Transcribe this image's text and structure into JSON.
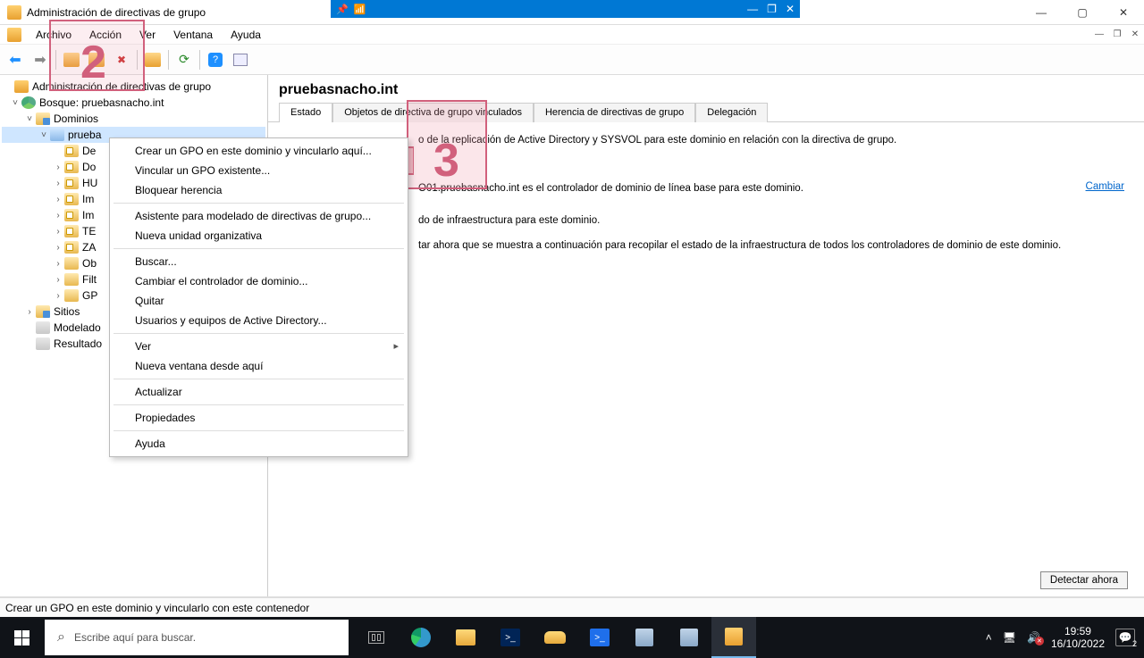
{
  "window": {
    "title": "Administración de directivas de grupo"
  },
  "remote_bar": {
    "min": "—",
    "restore": "❐",
    "close": "✕"
  },
  "outer_win": {
    "min": "—",
    "max": "▢",
    "close": "✕"
  },
  "mdi": {
    "min": "—",
    "restore": "❐",
    "close": "✕"
  },
  "menu": {
    "archivo": "Archivo",
    "accion": "Acción",
    "ver": "Ver",
    "ventana": "Ventana",
    "ayuda": "Ayuda"
  },
  "tree": {
    "root": "Administración de directivas de grupo",
    "forest": "Bosque: pruebasnacho.int",
    "domains": "Dominios",
    "domain": "prueba",
    "items": [
      "De",
      "Do",
      "HU",
      "Im",
      "Im",
      "TE",
      "ZA",
      "Ob",
      "Filt",
      "GP"
    ],
    "sitios": "Sitios",
    "modelado": "Modelado",
    "resultados": "Resultado"
  },
  "ctx": {
    "i0": "Crear un GPO en este dominio y vincularlo aquí...",
    "i1": "Vincular un GPO existente...",
    "i2": "Bloquear herencia",
    "i3": "Asistente para modelado de directivas de grupo...",
    "i4": "Nueva unidad organizativa",
    "i5": "Buscar...",
    "i6": "Cambiar el controlador de dominio...",
    "i7": "Quitar",
    "i8": "Usuarios y equipos de Active Directory...",
    "i9": "Ver",
    "i10": "Nueva ventana desde aquí",
    "i11": "Actualizar",
    "i12": "Propiedades",
    "i13": "Ayuda"
  },
  "content": {
    "title": "pruebasnacho.int",
    "tabs": {
      "estado": "Estado",
      "objetos": "Objetos de directiva de grupo vinculados",
      "herencia": "Herencia de directivas de grupo",
      "delegacion": "Delegación"
    },
    "line1": "o de la replicación de Active Directory y SYSVOL para este dominio en relación con la directiva de grupo.",
    "line2": "O01.pruebasnacho.int es el controlador de dominio de línea base para este dominio.",
    "link_cambiar": "Cambiar",
    "line3": "do de infraestructura para este dominio.",
    "line4": "tar ahora que se muestra a continuación para recopilar el estado de la infraestructura de todos los controladores de dominio de este dominio.",
    "detect": "Detectar ahora"
  },
  "status": "Crear un GPO en este dominio y vincularlo con este contenedor",
  "taskbar": {
    "search_placeholder": "Escribe aquí para buscar.",
    "time": "19:59",
    "date": "16/10/2022",
    "notif_count": "2"
  },
  "annot": {
    "n2": "2",
    "n3": "3"
  }
}
